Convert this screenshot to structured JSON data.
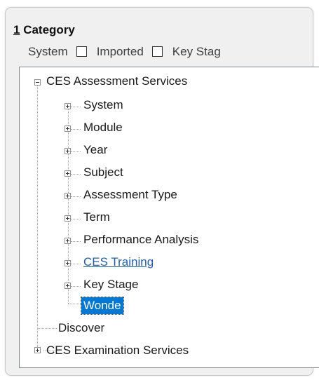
{
  "header": {
    "mnemonic": "1",
    "title": "Category"
  },
  "filters": [
    {
      "label": "System",
      "checked": false
    },
    {
      "label": "Imported",
      "checked": false
    },
    {
      "label": "Key Stag",
      "checked": false
    }
  ],
  "tree": {
    "root": "CES Assessment Services",
    "children": [
      "System",
      "Module",
      "Year",
      "Subject",
      "Assessment Type",
      "Term",
      "Performance Analysis",
      "CES Training",
      "Key Stage",
      "Wonde"
    ],
    "siblings": [
      "Discover",
      "CES Examination Services"
    ]
  },
  "colors": {
    "selection": "#0078d7",
    "link": "#1e5fb4",
    "panel": "#f0f0f0"
  }
}
